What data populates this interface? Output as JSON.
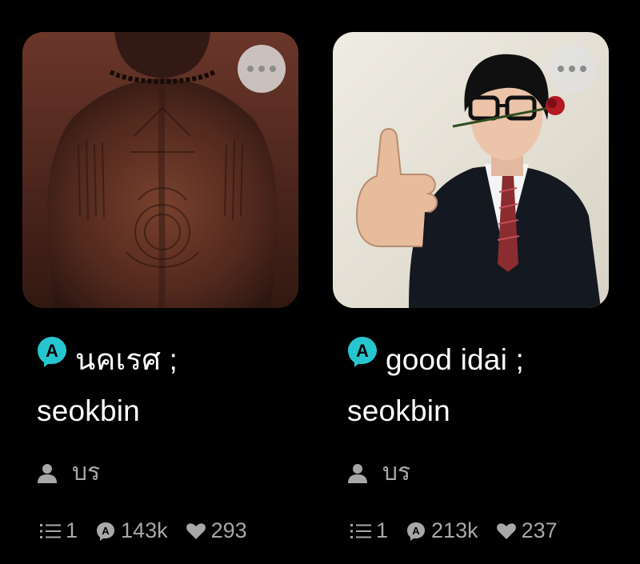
{
  "colors": {
    "background": "#000000",
    "badge_accent": "#26c6d0",
    "text_primary": "#ffffff",
    "text_secondary": "#a8a8a8"
  },
  "stories": [
    {
      "title_line1": "นคเรศ ;",
      "title_line2": "seokbin",
      "author": "บร",
      "parts": "1",
      "reads": "143k",
      "votes": "293",
      "more_icon": "more-horizontal-icon"
    },
    {
      "title_line1": "good idai ;",
      "title_line2": "seokbin",
      "author": "บร",
      "parts": "1",
      "reads": "213k",
      "votes": "237",
      "more_icon": "more-horizontal-icon"
    }
  ]
}
